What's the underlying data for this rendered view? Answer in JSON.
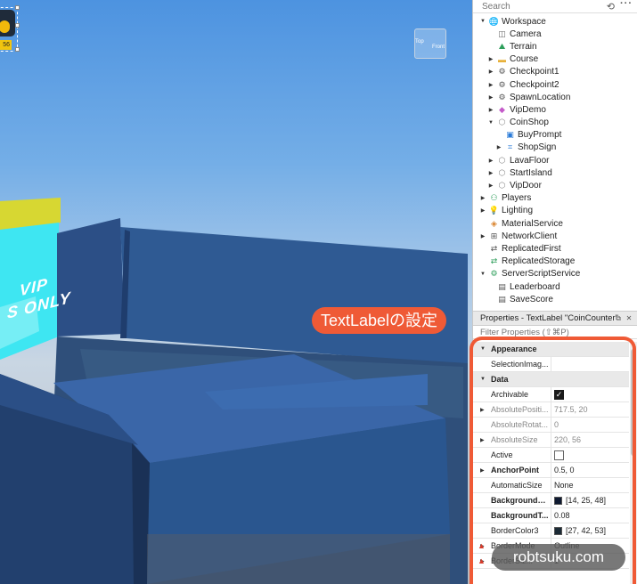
{
  "viewport": {
    "coin_count": "56",
    "vip_line1": "VIP",
    "vip_line2": "S ONLY",
    "callout": "TextLabelの設定",
    "view_cube_top": "Top",
    "view_cube_front": "Front"
  },
  "explorer": {
    "search_placeholder": "Search",
    "items": [
      {
        "label": "Workspace",
        "depth": 0,
        "arrow": "open",
        "icon": "workspace-icon"
      },
      {
        "label": "Camera",
        "depth": 1,
        "arrow": "none",
        "icon": "camera-icon"
      },
      {
        "label": "Terrain",
        "depth": 1,
        "arrow": "none",
        "icon": "terrain-icon"
      },
      {
        "label": "Course",
        "depth": 1,
        "arrow": "closed",
        "icon": "folder-icon"
      },
      {
        "label": "Checkpoint1",
        "depth": 1,
        "arrow": "closed",
        "icon": "gear-icon"
      },
      {
        "label": "Checkpoint2",
        "depth": 1,
        "arrow": "closed",
        "icon": "gear-icon"
      },
      {
        "label": "SpawnLocation",
        "depth": 1,
        "arrow": "closed",
        "icon": "gear-icon"
      },
      {
        "label": "VipDemo",
        "depth": 1,
        "arrow": "closed",
        "icon": "model-icon"
      },
      {
        "label": "CoinShop",
        "depth": 1,
        "arrow": "open",
        "icon": "part-icon"
      },
      {
        "label": "BuyPrompt",
        "depth": 2,
        "arrow": "none",
        "icon": "prompt-icon"
      },
      {
        "label": "ShopSign",
        "depth": 2,
        "arrow": "closed",
        "icon": "gui-icon"
      },
      {
        "label": "LavaFloor",
        "depth": 1,
        "arrow": "closed",
        "icon": "part-icon"
      },
      {
        "label": "StartIsland",
        "depth": 1,
        "arrow": "closed",
        "icon": "part-icon"
      },
      {
        "label": "VipDoor",
        "depth": 1,
        "arrow": "closed",
        "icon": "part-icon"
      },
      {
        "label": "Players",
        "depth": 0,
        "arrow": "closed",
        "icon": "players-icon"
      },
      {
        "label": "Lighting",
        "depth": 0,
        "arrow": "closed",
        "icon": "lighting-icon"
      },
      {
        "label": "MaterialService",
        "depth": 0,
        "arrow": "none",
        "icon": "material-icon"
      },
      {
        "label": "NetworkClient",
        "depth": 0,
        "arrow": "closed",
        "icon": "network-icon"
      },
      {
        "label": "ReplicatedFirst",
        "depth": 0,
        "arrow": "none",
        "icon": "replicated-icon"
      },
      {
        "label": "ReplicatedStorage",
        "depth": 0,
        "arrow": "none",
        "icon": "storage-icon"
      },
      {
        "label": "ServerScriptService",
        "depth": 0,
        "arrow": "open",
        "icon": "script-service-icon"
      },
      {
        "label": "Leaderboard",
        "depth": 1,
        "arrow": "none",
        "icon": "script-icon"
      },
      {
        "label": "SaveScore",
        "depth": 1,
        "arrow": "none",
        "icon": "script-icon"
      }
    ]
  },
  "properties": {
    "title": "Properties - TextLabel \"CoinCounter\"",
    "filter_placeholder": "Filter Properties (⇧⌘P)",
    "rows": [
      {
        "kind": "category",
        "name": "Appearance"
      },
      {
        "kind": "prop",
        "name": "SelectionImag...",
        "value": "",
        "style": "normal"
      },
      {
        "kind": "category",
        "name": "Data"
      },
      {
        "kind": "prop",
        "name": "Archivable",
        "value": "",
        "checkbox": true,
        "style": "normal"
      },
      {
        "kind": "prop",
        "name": "AbsolutePositi...",
        "value": "717.5, 20",
        "style": "dim",
        "expand": true
      },
      {
        "kind": "prop",
        "name": "AbsoluteRotat...",
        "value": "0",
        "style": "dim"
      },
      {
        "kind": "prop",
        "name": "AbsoluteSize",
        "value": "220, 56",
        "style": "dim",
        "expand": true
      },
      {
        "kind": "prop",
        "name": "Active",
        "value": "",
        "checkbox": false,
        "style": "normal"
      },
      {
        "kind": "prop",
        "name": "AnchorPoint",
        "value": "0.5, 0",
        "style": "bold",
        "expand": true
      },
      {
        "kind": "prop",
        "name": "AutomaticSize",
        "value": "None",
        "style": "normal"
      },
      {
        "kind": "prop",
        "name": "BackgroundC...",
        "value": "[14, 25, 48]",
        "swatch": "#0e1930",
        "style": "bold"
      },
      {
        "kind": "prop",
        "name": "BackgroundT...",
        "value": "0.08",
        "style": "bold"
      },
      {
        "kind": "prop",
        "name": "BorderColor3",
        "value": "[27, 42, 53]",
        "swatch": "#1b2a35",
        "style": "normal"
      },
      {
        "kind": "prop",
        "name": "BorderMode",
        "value": "Outline",
        "style": "normal",
        "expand": true,
        "warn": true
      },
      {
        "kind": "prop",
        "name": "BorderSiz...",
        "value": "1",
        "style": "normal",
        "expand": true,
        "warn": true
      }
    ]
  },
  "watermark": "robtsuku.com",
  "colors": {
    "accent": "#ef5a36",
    "callout_text": "#ffffff"
  }
}
